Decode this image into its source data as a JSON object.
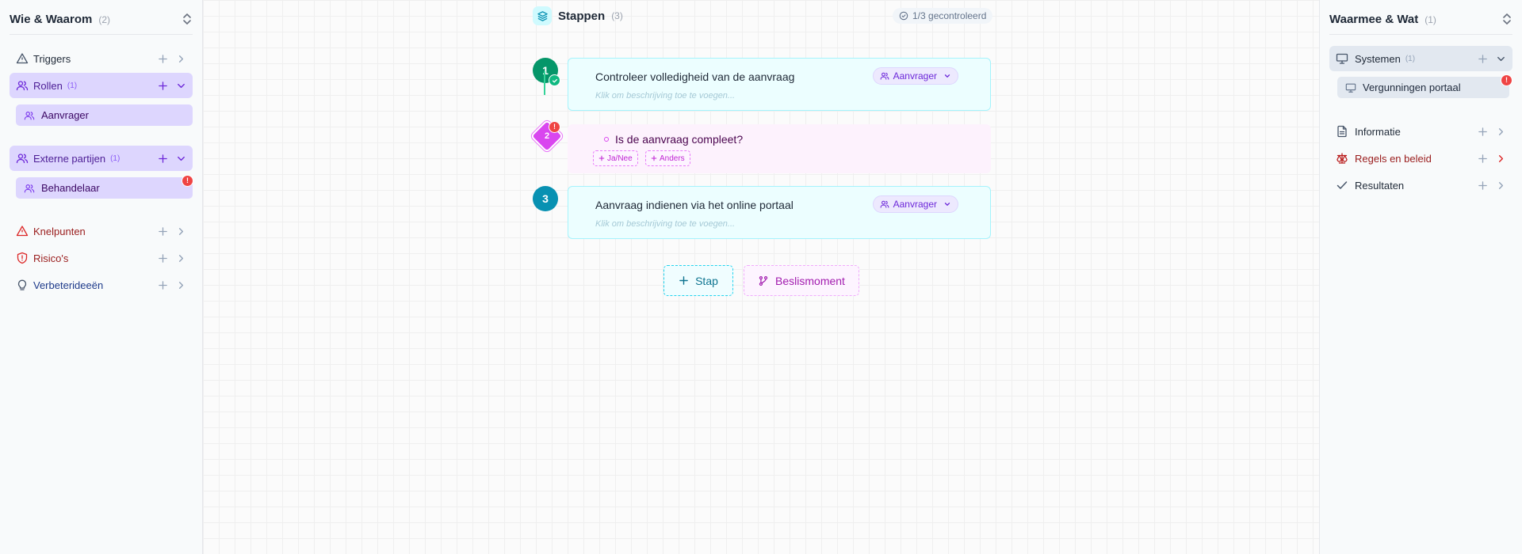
{
  "left_sidebar": {
    "title": "Wie & Waarom",
    "count": "(2)",
    "sections": {
      "triggers": {
        "label": "Triggers"
      },
      "rollen": {
        "label": "Rollen",
        "count": "(1)",
        "children": [
          "Aanvrager"
        ]
      },
      "externe": {
        "label": "Externe partijen",
        "count": "(1)",
        "children": [
          "Behandelaar"
        ],
        "badge": "!"
      },
      "knelpunten": {
        "label": "Knelpunten"
      },
      "risicos": {
        "label": "Risico's"
      },
      "verbeter": {
        "label": "Verbeterideeën"
      }
    }
  },
  "canvas": {
    "title": "Stappen",
    "count": "(3)",
    "checked": "1/3 gecontroleerd",
    "steps": [
      {
        "number": "1",
        "title": "Controleer volledigheid van de aanvraag",
        "description": "Klik om beschrijving toe te voegen...",
        "role": "Aanvrager",
        "color": "#059669"
      },
      {
        "number": "3",
        "title": "Aanvraag indienen via het online portaal",
        "description": "Klik om beschrijving toe te voegen...",
        "role": "Aanvrager",
        "color": "#0891b2"
      }
    ],
    "decision": {
      "number": "2",
      "question": "Is de aanvraag compleet?",
      "badge": "!",
      "options": [
        "Ja/Nee",
        "Anders"
      ]
    },
    "add_step_label": "Stap",
    "add_decision_label": "Beslismoment"
  },
  "right_sidebar": {
    "title": "Waarmee & Wat",
    "count": "(1)",
    "sections": {
      "systemen": {
        "label": "Systemen",
        "count": "(1)",
        "children": [
          "Vergunningen portaal"
        ],
        "badge": "!"
      },
      "informatie": {
        "label": "Informatie"
      },
      "regels": {
        "label": "Regels en beleid"
      },
      "resultaten": {
        "label": "Resultaten"
      }
    }
  },
  "colors": {
    "accent_violet": "#ddd6fe",
    "accent_cyan": "#ecfeff",
    "accent_fuchsia": "#d946ef",
    "danger": "#ef4444"
  }
}
